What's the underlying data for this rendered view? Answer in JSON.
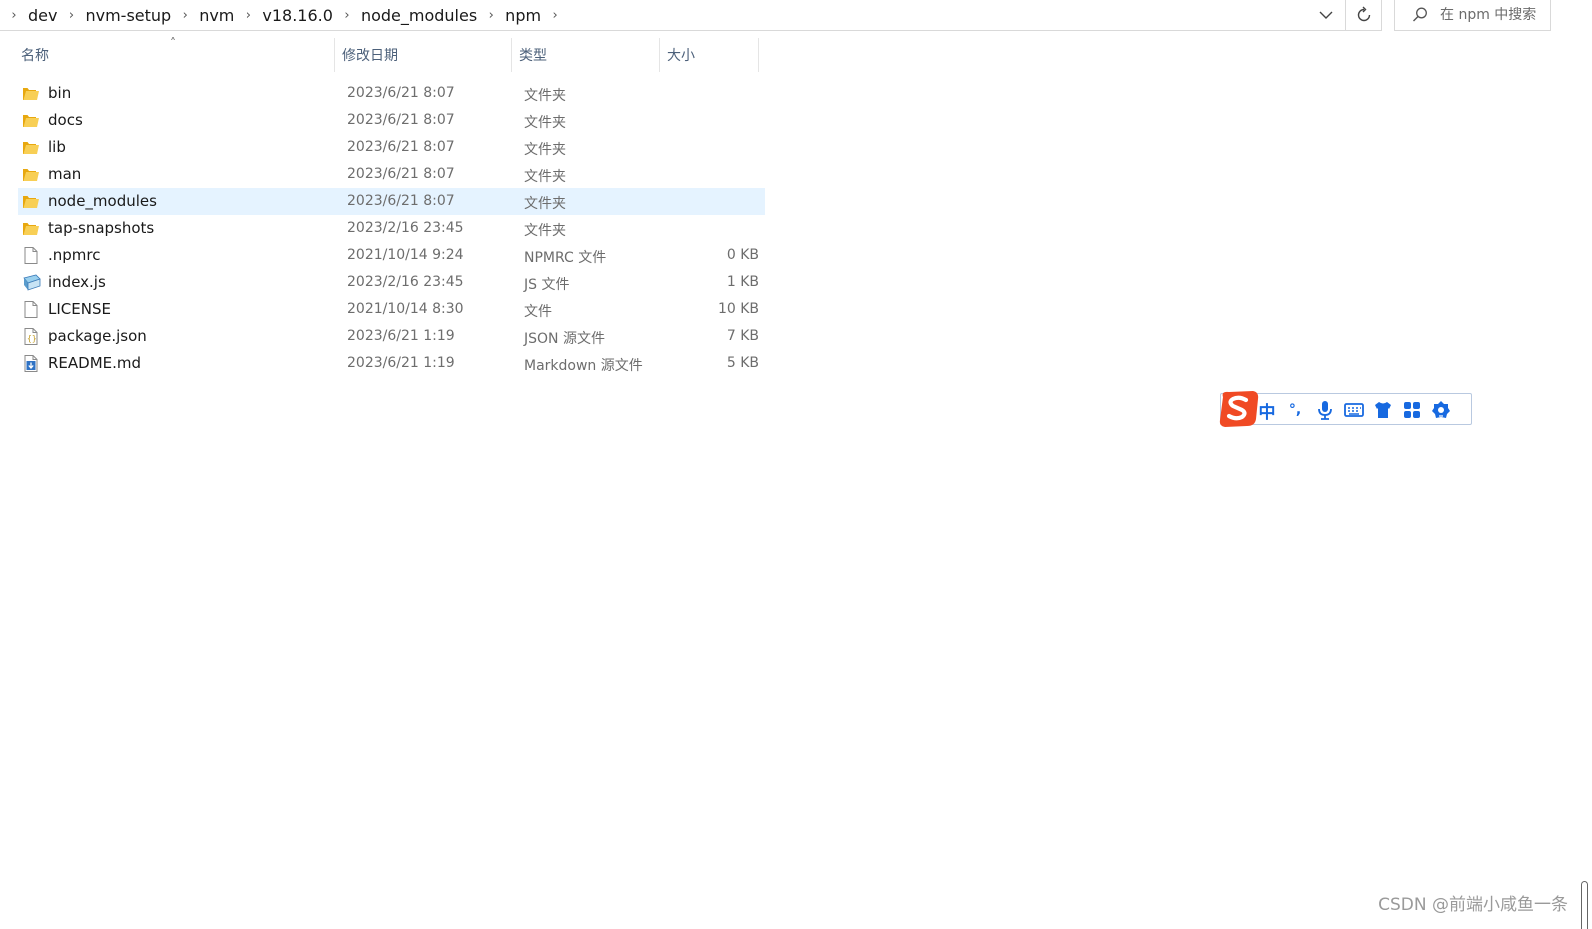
{
  "address_bar": {
    "breadcrumbs": [
      "dev",
      "nvm-setup",
      "nvm",
      "v18.16.0",
      "node_modules",
      "npm"
    ],
    "search_placeholder": "在 npm 中搜索"
  },
  "columns": {
    "name": "名称",
    "modified": "修改日期",
    "type": "类型",
    "size": "大小",
    "sorted_by": "名称"
  },
  "files": [
    {
      "name": "bin",
      "modified": "2023/6/21 8:07",
      "type": "文件夹",
      "size": "",
      "icon": "folder-icon"
    },
    {
      "name": "docs",
      "modified": "2023/6/21 8:07",
      "type": "文件夹",
      "size": "",
      "icon": "folder-icon"
    },
    {
      "name": "lib",
      "modified": "2023/6/21 8:07",
      "type": "文件夹",
      "size": "",
      "icon": "folder-icon"
    },
    {
      "name": "man",
      "modified": "2023/6/21 8:07",
      "type": "文件夹",
      "size": "",
      "icon": "folder-icon"
    },
    {
      "name": "node_modules",
      "modified": "2023/6/21 8:07",
      "type": "文件夹",
      "size": "",
      "icon": "folder-icon",
      "selected": true
    },
    {
      "name": "tap-snapshots",
      "modified": "2023/2/16 23:45",
      "type": "文件夹",
      "size": "",
      "icon": "folder-icon"
    },
    {
      "name": ".npmrc",
      "modified": "2021/10/14 9:24",
      "type": "NPMRC 文件",
      "size": "0 KB",
      "icon": "blank-file-icon"
    },
    {
      "name": "index.js",
      "modified": "2023/2/16 23:45",
      "type": "JS 文件",
      "size": "1 KB",
      "icon": "js-file-icon"
    },
    {
      "name": "LICENSE",
      "modified": "2021/10/14 8:30",
      "type": "文件",
      "size": "10 KB",
      "icon": "blank-file-icon"
    },
    {
      "name": "package.json",
      "modified": "2023/6/21 1:19",
      "type": "JSON 源文件",
      "size": "7 KB",
      "icon": "json-file-icon"
    },
    {
      "name": "README.md",
      "modified": "2023/6/21 1:19",
      "type": "Markdown 源文件",
      "size": "5 KB",
      "icon": "markdown-file-icon"
    }
  ],
  "ime_toolbar": {
    "mode_label": "中",
    "punct_label": "°,",
    "tools": [
      "sogou-logo-icon",
      "voice-input-icon",
      "keyboard-icon",
      "skin-shirt-icon",
      "toolbox-grid-icon",
      "settings-icon"
    ]
  },
  "watermark": "CSDN @前端小咸鱼一条",
  "colors": {
    "selection": "#e5f3ff",
    "header_text": "#4c607a",
    "folder": "#f5c441",
    "ime_blue": "#1769e0",
    "sogou_red": "#f04a24"
  }
}
